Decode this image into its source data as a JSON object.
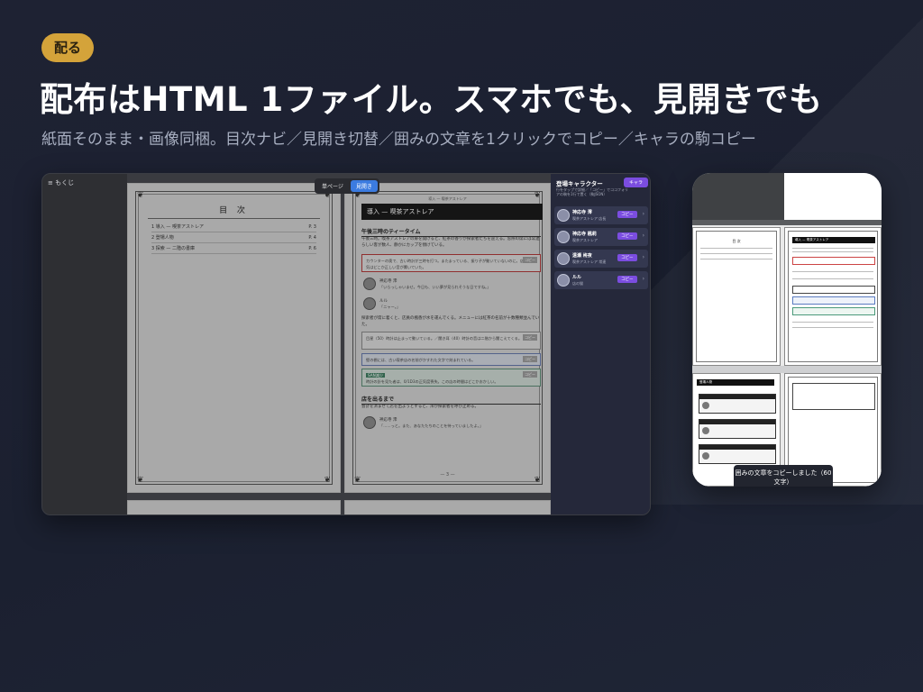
{
  "badge": "配る",
  "headline": "配布はHTML 1ファイル。スマホでも、見開きでも",
  "subline": "紙面そのまま・画像同梱。目次ナビ／見開き切替／囲みの文章を1クリックでコピー／キャラの駒コピー",
  "desktop": {
    "toc_toggle": "≡ もくじ",
    "view_single": "単ページ",
    "view_spread": "見開き",
    "toc_page": {
      "title": "目 次",
      "items": [
        {
          "label": "1 導入 — 喫茶アストレア",
          "page": "P. 3"
        },
        {
          "label": "2 登場人物",
          "page": "P. 4"
        },
        {
          "label": "3 探索 — 二階の書庫",
          "page": "P. 6"
        }
      ]
    },
    "story_page": {
      "header": "導入 — 喫茶アストレア",
      "section_title": "導入 — 喫茶アストレア",
      "sub1": "午後三時のティータイム",
      "para1": "午後三時。喫茶アストレアの扉を開けると、紅茶の香りが探索者たちを迎える。窓際の席には常連らしい客が数人、静かにカップを傾けている。",
      "box_red": "カウンターの奥で、古い時計が三時を打つ。またまっている、振り子が動いていないのに。店内の空気はどこか正しい音が響いていた。",
      "speaker1_name": "神応寺 澪",
      "speaker1_text": "「いらっしゃいませ。今日も、いい夢が見られそうな日ですね。」",
      "speaker2_name": "ルル",
      "speaker2_text": "「ニャー。」",
      "para2": "探索者が席に着くと、店員の楓香が水を運んでくる。メニューには紅茶の名前が十数種類並んでいた。",
      "box_plain": "目星〈50〉時計は止まって動いている。／聞き耳〈40〉時計の音は二階から聞こえてくる。",
      "box_blue": "壁の棚には、古い喫茶店の名前がかすれた文字で刻まれている。",
      "box_teal_tag": "SAN減少",
      "box_teal": "時計の針を見た者は、0/1D3の正気度喪失。この店の時間はどこかおかしい。",
      "sub2": "店を出るまで",
      "para3": "会計を済ませて店を出ようとすると、澪が探索者を呼び止める。",
      "speaker3_name": "神応寺 澪",
      "speaker3_text": "「……っと。また、あなたたちのことを待っていましたよ。」",
      "copy_tag": "コピー",
      "page_num": "— 3 —"
    },
    "characters": {
      "title": "登場キャラクター",
      "hint": "行をタップで詳細／「コピー」でココフォリアの駒を1行で置く（駒JSON）",
      "button": "キャラ",
      "copy_label": "コピー",
      "list": [
        {
          "name": "神応寺 澪",
          "role": "喫茶アストレア 店長"
        },
        {
          "name": "神応寺 楓莉",
          "role": "喫茶アストレア"
        },
        {
          "name": "遠瀬 柊夜",
          "role": "喫茶アストレア 常連"
        },
        {
          "name": "ルル",
          "role": "店の猫"
        }
      ]
    }
  },
  "phone": {
    "toc_title": "目 次",
    "section_title": "導入 — 喫茶アストレア",
    "char_title": "登場人物",
    "toast": "囲みの文章をコピーしました（60文字）"
  }
}
